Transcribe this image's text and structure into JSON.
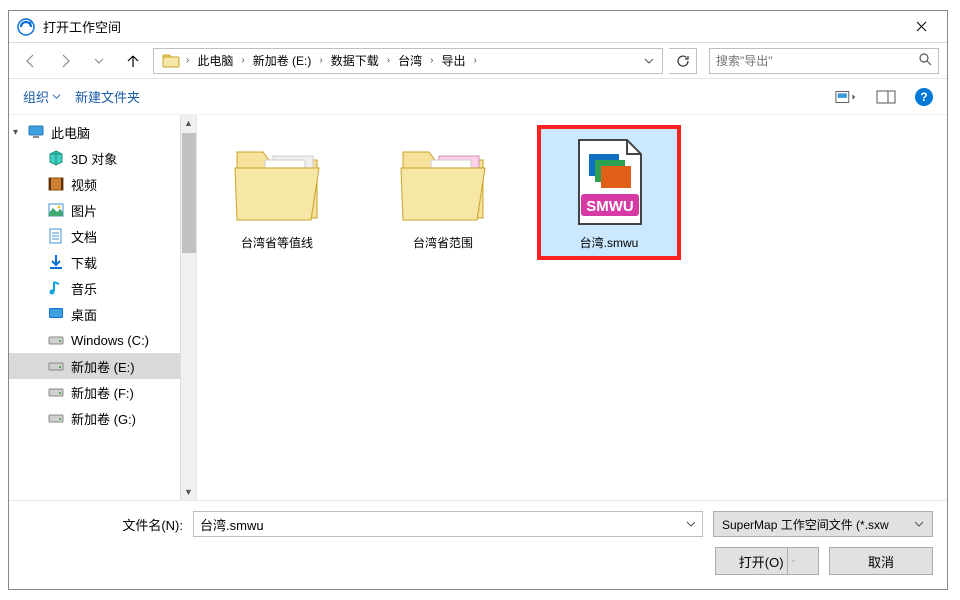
{
  "title": "打开工作空间",
  "breadcrumb": [
    "此电脑",
    "新加卷 (E:)",
    "数据下载",
    "台湾",
    "导出"
  ],
  "search_placeholder": "搜索\"导出\"",
  "toolbar": {
    "organize": "组织",
    "newfolder": "新建文件夹"
  },
  "tree": [
    {
      "label": "此电脑",
      "icon": "pc"
    },
    {
      "label": "3D 对象",
      "icon": "3d",
      "child": true
    },
    {
      "label": "视频",
      "icon": "video",
      "child": true
    },
    {
      "label": "图片",
      "icon": "pictures",
      "child": true
    },
    {
      "label": "文档",
      "icon": "docs",
      "child": true
    },
    {
      "label": "下载",
      "icon": "downloads",
      "child": true
    },
    {
      "label": "音乐",
      "icon": "music",
      "child": true
    },
    {
      "label": "桌面",
      "icon": "desktop",
      "child": true
    },
    {
      "label": "Windows (C:)",
      "icon": "drive",
      "child": true
    },
    {
      "label": "新加卷 (E:)",
      "icon": "drive",
      "child": true,
      "selected": true
    },
    {
      "label": "新加卷 (F:)",
      "icon": "drive",
      "child": true
    },
    {
      "label": "新加卷 (G:)",
      "icon": "drive",
      "child": true
    }
  ],
  "files": [
    {
      "name": "台湾省等值线",
      "type": "folder"
    },
    {
      "name": "台湾省范围",
      "type": "folder-pink"
    },
    {
      "name": "台湾.smwu",
      "type": "smwu",
      "selected": true,
      "highlighted": true
    }
  ],
  "smwu_badge": "SMWU",
  "filename_label": "文件名(N):",
  "filename_value": "台湾.smwu",
  "filetype_value": "SuperMap 工作空间文件 (*.sxw",
  "open_btn": "打开(O)",
  "cancel_btn": "取消"
}
